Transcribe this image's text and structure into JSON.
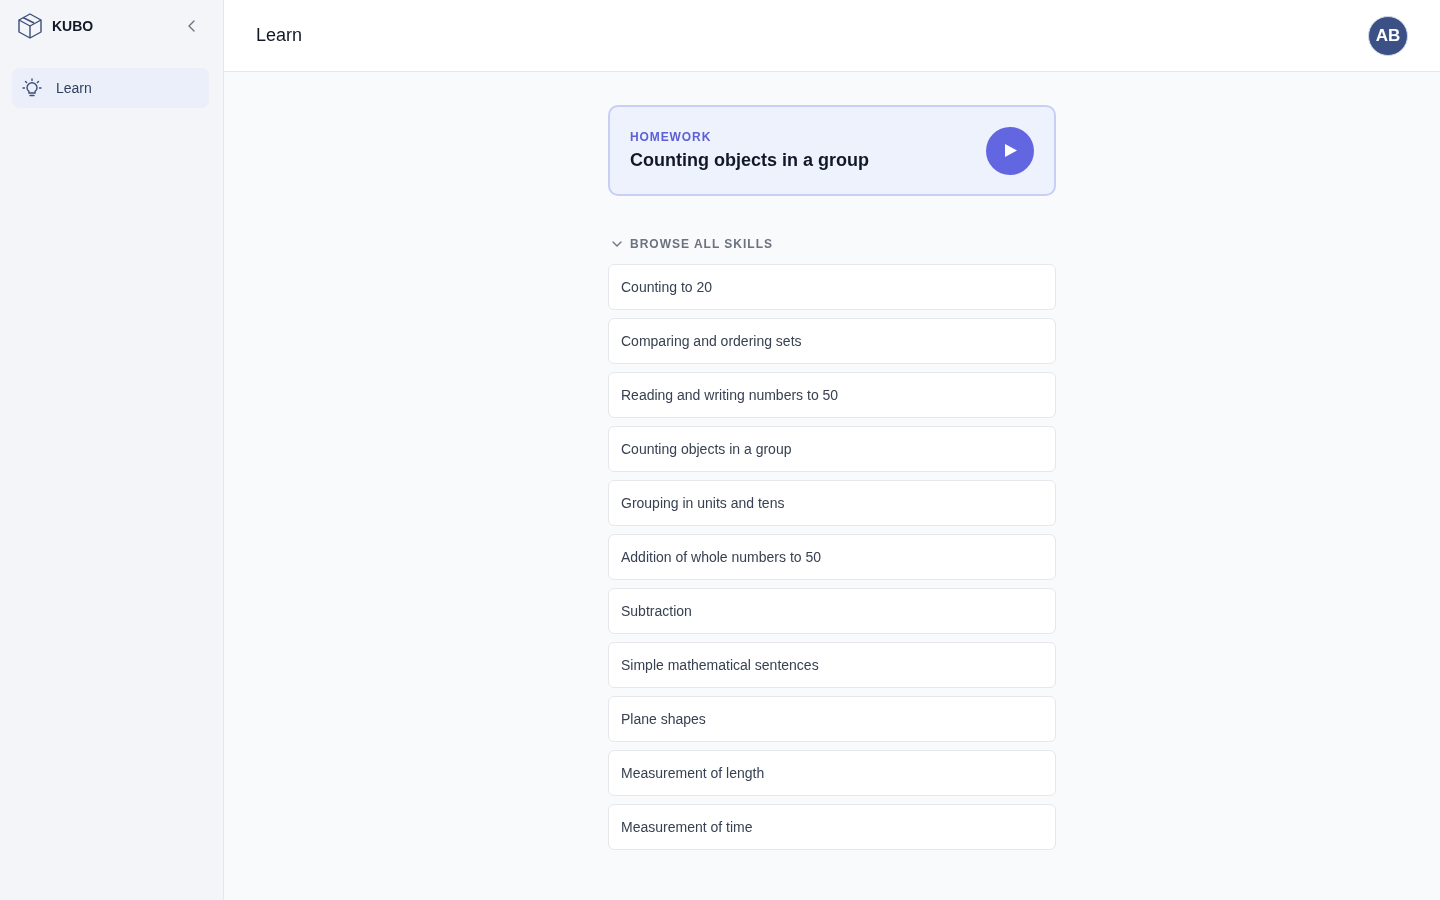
{
  "sidebar": {
    "brand": "KUBO",
    "items": [
      {
        "label": "Learn",
        "selected": true
      }
    ]
  },
  "header": {
    "title": "Learn",
    "avatar": "AB"
  },
  "homework": {
    "label": "HOMEWORK",
    "title": "Counting objects in a group"
  },
  "skills": {
    "heading": "BROWSE ALL SKILLS",
    "expanded": true,
    "items": [
      "Counting to 20",
      "Comparing and ordering sets",
      "Reading and writing numbers to 50",
      "Counting objects in a group",
      "Grouping in units and tens",
      "Addition of whole numbers to 50",
      "Subtraction",
      "Simple mathematical sentences",
      "Plane shapes",
      "Measurement of length",
      "Measurement of time"
    ]
  }
}
